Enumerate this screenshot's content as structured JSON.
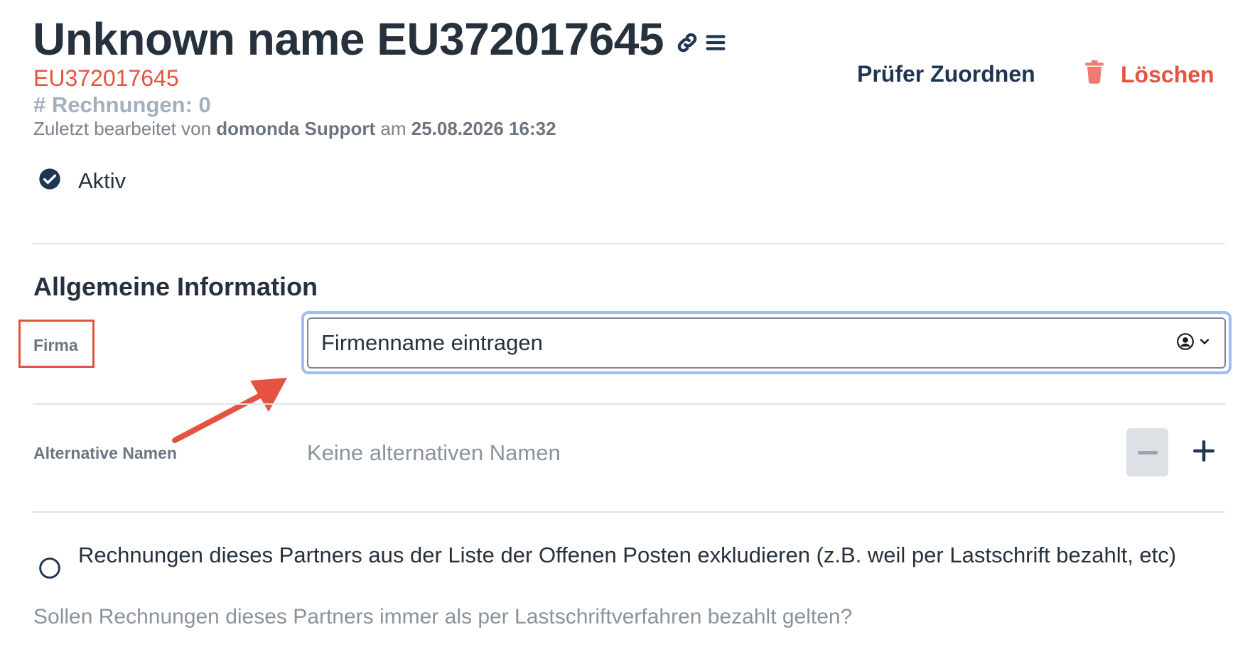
{
  "header": {
    "title": "Unknown name EU372017645",
    "code": "EU372017645",
    "invoice_count": "# Rechnungen: 0",
    "edited_prefix": "Zuletzt bearbeitet von",
    "edited_user": "domonda Support",
    "edited_mid": "am",
    "edited_datetime": "25.08.2026 16:32",
    "icons": [
      "link-icon",
      "menu-icon"
    ]
  },
  "actions": {
    "assign_label": "Prüfer Zuordnen",
    "delete_label": "Löschen"
  },
  "status": {
    "active_label": "Aktiv",
    "active_checked": true
  },
  "general": {
    "section_title": "Allgemeine Information",
    "company_label": "Firma",
    "company_placeholder": "Firmenname eintragen",
    "alt_names_label": "Alternative Namen",
    "alt_names_empty": "Keine alternativen Namen"
  },
  "exclude": {
    "label": "Rechnungen dieses Partners aus der Liste der Offenen Posten exkludieren (z.B. weil per Lastschrift bezahlt, etc)",
    "checked": false,
    "help": "Sollen Rechnungen dieses Partners immer als per Lastschriftverfahren bezahlt gelten?"
  },
  "colors": {
    "accent_red": "#e4533f",
    "navy": "#1f3554",
    "focus_ring": "#9fbdf1",
    "delete_icon": "#f07a70"
  }
}
